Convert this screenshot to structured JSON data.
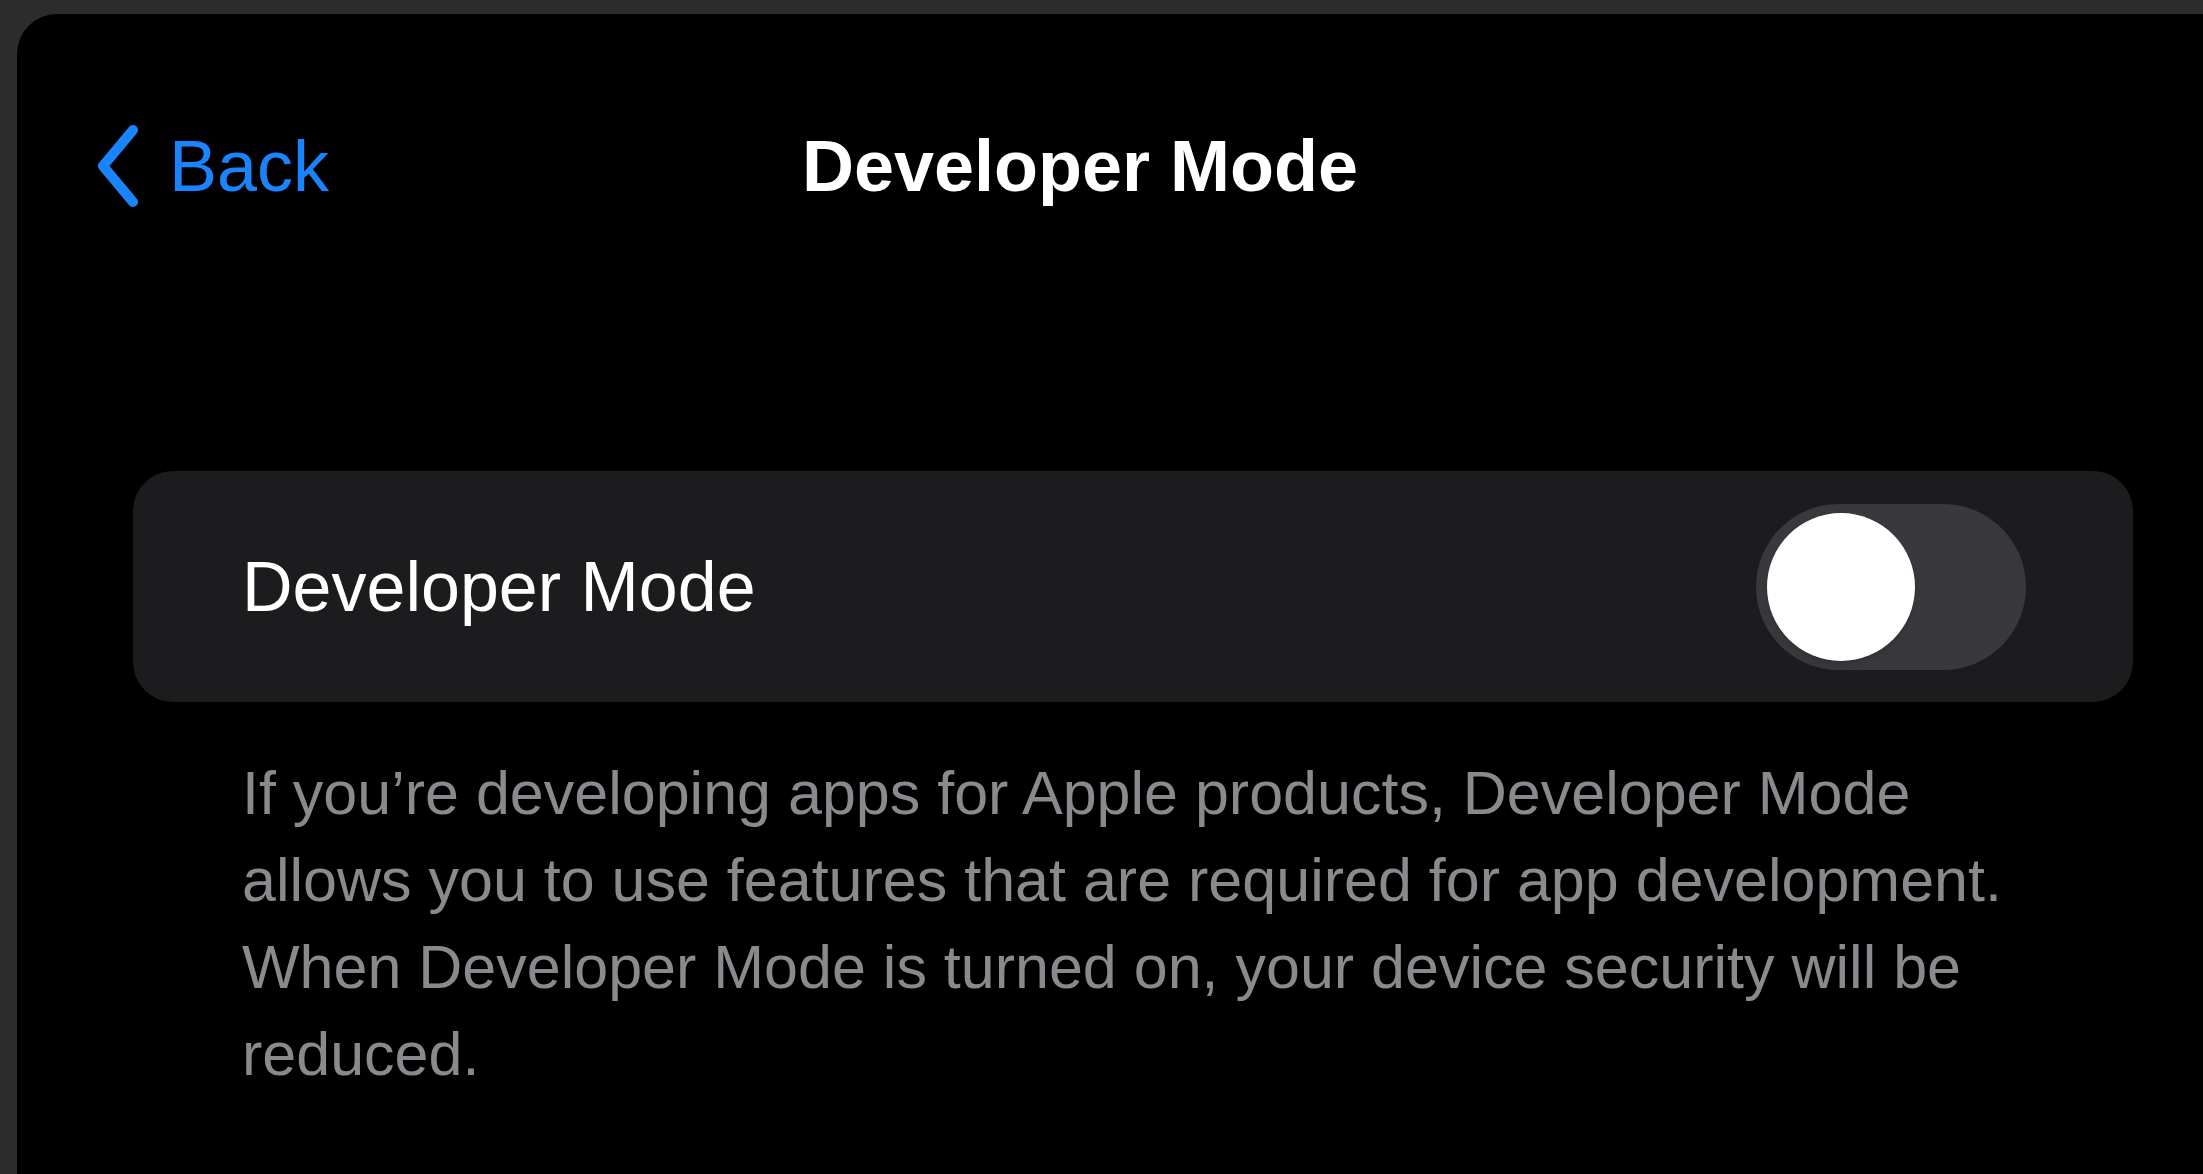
{
  "nav_bar": {
    "back_label": "Back",
    "title": "Developer Mode"
  },
  "setting": {
    "label": "Developer Mode",
    "on": false
  },
  "footer": "If you’re developing apps for Apple products, Developer Mode allows you to use features that are required for app development. When Developer Mode is turned on, your device security will be reduced."
}
